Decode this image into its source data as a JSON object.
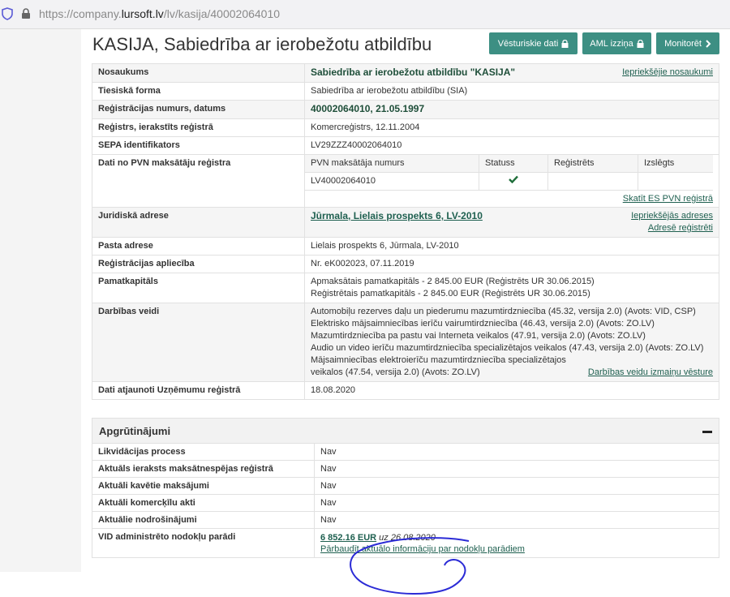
{
  "browser": {
    "url_prefix": "https://company.",
    "url_domain": "lursoft.lv",
    "url_path": "/lv/kasija/40002064010"
  },
  "header": {
    "title": "KASIJA, Sabiedrība ar ierobežotu atbildību",
    "buttons": {
      "history": "Vēsturiskie dati",
      "aml": "AML izziņa",
      "monitor": "Monitorēt"
    }
  },
  "info": {
    "name": {
      "label": "Nosaukums",
      "value": "Sabiedrība ar ierobežotu atbildību \"KASIJA\"",
      "link": "Iepriekšējie nosaukumi"
    },
    "legal_form": {
      "label": "Tiesiskā forma",
      "value": "Sabiedrība ar ierobežotu atbildību (SIA)"
    },
    "reg_number": {
      "label": "Reģistrācijas numurs, datums",
      "value": "40002064010, 21.05.1997"
    },
    "register": {
      "label": "Reģistrs, ierakstīts reģistrā",
      "value": "Komercreģistrs, 12.11.2004"
    },
    "sepa": {
      "label": "SEPA identifikators",
      "value": "LV29ZZZ40002064010"
    },
    "pvn": {
      "label": "Dati no PVN maksātāju reģistra",
      "headers": [
        "PVN maksātāja numurs",
        "Statuss",
        "Reģistrēts",
        "Izslēgts"
      ],
      "number": "LV40002064010",
      "status_icon": "check-icon",
      "registered": "",
      "excluded": "",
      "link": "Skatīt ES PVN reģistrā"
    },
    "address": {
      "label": "Juridiskā adrese",
      "value": "Jūrmala, Lielais prospekts 6, LV-2010",
      "link1": "Iepriekšējās adreses",
      "link2": "Adresē reģistrēti"
    },
    "post": {
      "label": "Pasta adrese",
      "value": "Lielais prospekts 6, Jūrmala, LV-2010"
    },
    "certificate": {
      "label": "Reģistrācijas apliecība",
      "value": "Nr. eK002023, 07.11.2019"
    },
    "capital": {
      "label": "Pamatkapitāls",
      "paid": "Apmaksātais pamatkapitāls - 2 845.00 EUR (Reģistrēts UR 30.06.2015)",
      "registered": "Reģistrētais pamatkapitāls - 2 845.00 EUR (Reģistrēts UR 30.06.2015)"
    },
    "activities": {
      "label": "Darbības veidi",
      "items": [
        "Automobiļu rezerves daļu un piederumu mazumtirdzniecība (45.32, versija 2.0) (Avots: VID, CSP)",
        "Elektrisko mājsaimniecības ierīču vairumtirdzniecība (46.43, versija 2.0) (Avots: ZO.LV)",
        "Mazumtirdzniecība pa pastu vai Interneta veikalos (47.91, versija 2.0) (Avots: ZO.LV)",
        "Audio un video ierīču mazumtirdzniecība specializētajos veikalos (47.43, versija 2.0) (Avots: ZO.LV)",
        "Mājsaimniecības elektroierīču mazumtirdzniecība specializētajos veikalos (47.54, versija 2.0) (Avots: ZO.LV)"
      ],
      "link": "Darbības veidu izmaiņu vēsture"
    },
    "updated": {
      "label": "Dati atjaunoti Uzņēmumu reģistrā",
      "value": "18.08.2020"
    }
  },
  "encumbrances": {
    "title": "Apgrūtinājumi",
    "rows": [
      {
        "label": "Likvidācijas process",
        "value": "Nav"
      },
      {
        "label": "Aktuāls ieraksts maksātnespējas reģistrā",
        "value": "Nav"
      },
      {
        "label": "Aktuāli kavētie maksājumi",
        "value": "Nav"
      },
      {
        "label": "Aktuāli komercķīlu akti",
        "value": "Nav"
      },
      {
        "label": "Aktuālie nodrošinājumi",
        "value": "Nav"
      }
    ],
    "tax": {
      "label": "VID administrēto nodokļu parādi",
      "amount": "6 852.16 EUR",
      "date": "uz 26.08.2020",
      "link": "Pārbaudīt aktuālo informāciju par nodokļu parādiem"
    }
  },
  "colors": {
    "accent": "#3d8f83",
    "link": "#1f6050",
    "circle": "#2b2bd6"
  }
}
